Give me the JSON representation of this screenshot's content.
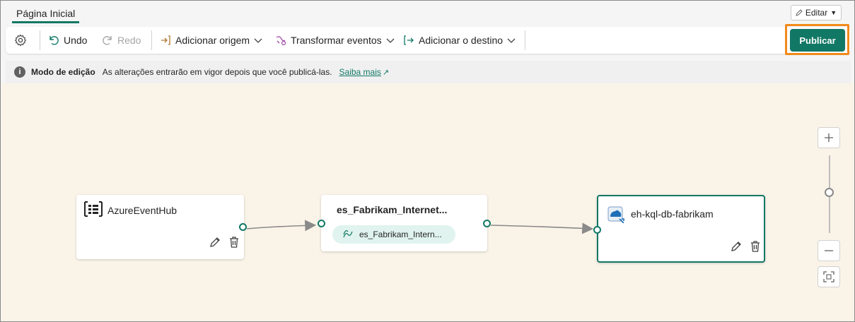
{
  "tabs": {
    "home": "Página Inicial"
  },
  "edit_button": {
    "label": "Editar",
    "icon": "pencil-icon"
  },
  "toolbar": {
    "settings_icon": "gear-icon",
    "undo": "Undo",
    "redo": "Redo",
    "add_source": "Adicionar origem",
    "transform_events": "Transformar eventos",
    "add_destination": "Adicionar o destino",
    "publish": "Publicar"
  },
  "infobar": {
    "mode": "Modo de edição",
    "message": "As alterações entrarão em vigor depois que você publicá-las.",
    "link": "Saiba mais"
  },
  "canvas": {
    "source_node": {
      "title": "AzureEventHub",
      "icon": "event-hub-icon"
    },
    "stream_node": {
      "title": "es_Fabrikam_Internet...",
      "pill": "es_Fabrikam_Intern...",
      "icon": "stream-icon"
    },
    "destination_node": {
      "title": "eh-kql-db-fabrikam",
      "icon": "kql-database-icon",
      "selected": true
    }
  },
  "colors": {
    "accent": "#117865",
    "publish_highlight": "#f28a1b",
    "canvas_bg": "#faf3e8",
    "pill_bg": "#e0f3ee"
  }
}
